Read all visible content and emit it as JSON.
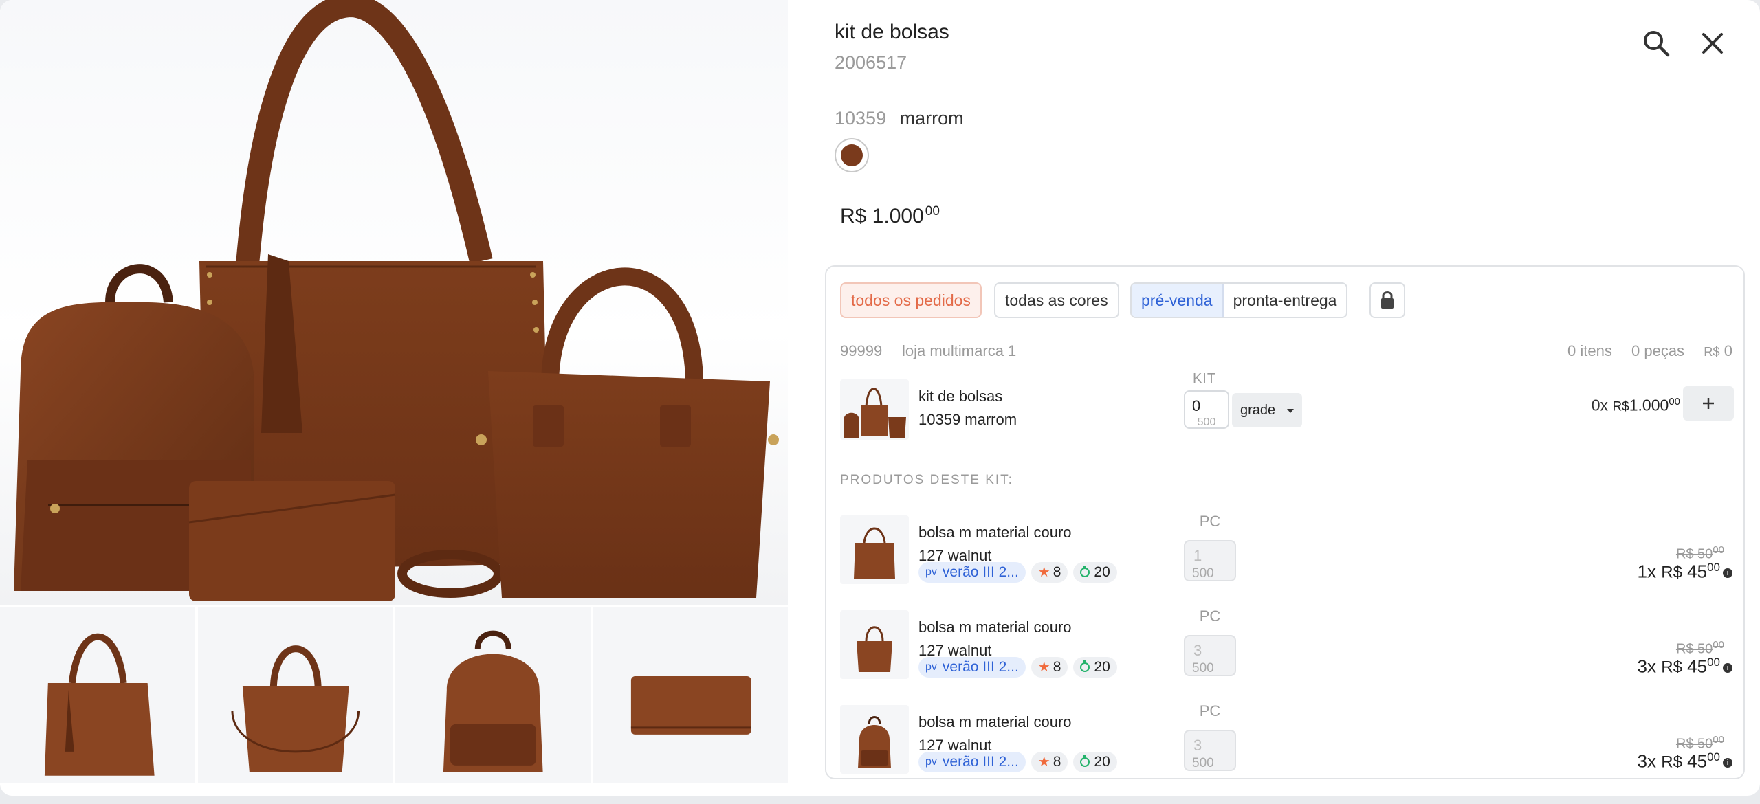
{
  "product": {
    "name": "kit de bolsas",
    "code": "2006517",
    "color_code": "10359",
    "color_name": "marrom",
    "swatch_color": "#7a3a1c",
    "price_main": "R$ 1.000",
    "price_cents": "00"
  },
  "header_icons": {
    "search": "search-icon",
    "close": "close-icon"
  },
  "filters": {
    "all_orders": "todos os pedidos",
    "all_colors": "todas as cores",
    "pre_sale": "pré-venda",
    "ready": "pronta-entrega",
    "lock_icon": "lock-icon"
  },
  "store": {
    "id": "99999",
    "name": "loja multimarca 1",
    "items": "0 itens",
    "pieces": "0 peças",
    "currency": "R$",
    "total": "0"
  },
  "kit": {
    "name": "kit de bolsas",
    "sub": "10359 marrom",
    "qty_label": "KIT",
    "qty": "0",
    "max": "500",
    "grade": "grade",
    "total_x": "0x",
    "total_cur": "R$",
    "total_value": "1.000",
    "total_cents": "00",
    "add_icon": "plus-icon"
  },
  "kit_section_title": "PRODUTOS DESTE KIT:",
  "kit_products": [
    {
      "name": "bolsa m material couro",
      "sub": "127 walnut",
      "pv": "pv",
      "collection": "verão III 2...",
      "stars": "8",
      "cycle": "20",
      "unit": "PC",
      "qty": "1",
      "max": "500",
      "old_price": "R$ 50",
      "old_cents": "00",
      "mult": "1x",
      "cur": "R$",
      "price": "45",
      "cents": "00"
    },
    {
      "name": "bolsa m material couro",
      "sub": "127 walnut",
      "pv": "pv",
      "collection": "verão III 2...",
      "stars": "8",
      "cycle": "20",
      "unit": "PC",
      "qty": "3",
      "max": "500",
      "old_price": "R$ 50",
      "old_cents": "00",
      "mult": "3x",
      "cur": "R$",
      "price": "45",
      "cents": "00"
    },
    {
      "name": "bolsa m material couro",
      "sub": "127 walnut",
      "pv": "pv",
      "collection": "verão III 2...",
      "stars": "8",
      "cycle": "20",
      "unit": "PC",
      "qty": "3",
      "max": "500",
      "old_price": "R$ 50",
      "old_cents": "00",
      "mult": "3x",
      "cur": "R$",
      "price": "45",
      "cents": "00"
    }
  ]
}
